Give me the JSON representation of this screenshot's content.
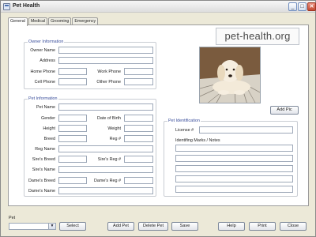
{
  "window": {
    "title": "Pet Health"
  },
  "title_controls": {
    "minimize": "_",
    "maximize": "□",
    "close": "✕"
  },
  "tabs": [
    "General",
    "Medical",
    "Grooming",
    "Emergency"
  ],
  "logo_text": "pet-health.org",
  "owner_info": {
    "title": "Owner Information",
    "labels": {
      "owner_name": "Owner Name",
      "address": "Address",
      "home_phone": "Home Phone",
      "work_phone": "Work Phone",
      "cell_phone": "Cell Phone",
      "other_phone": "Other Phone"
    }
  },
  "pet_info": {
    "title": "Pet Information",
    "labels": {
      "pet_name": "Pet Name",
      "gender": "Gender",
      "date_of_birth": "Date of Birth",
      "height": "Height",
      "weight": "Weight",
      "breed": "Breed",
      "reg_num": "Reg #",
      "reg_name": "Reg Name",
      "sires_breed": "Sire's Breed",
      "sires_reg": "Sire's Reg #",
      "sires_name": "Sire's Name",
      "dames_breed": "Dame's Breed",
      "dames_reg": "Dame's Reg #",
      "dames_name": "Dame's Name"
    }
  },
  "pet_id": {
    "title": "Pet Identification",
    "license_label": "License #",
    "marks_label": "Identifing Marks / Notes"
  },
  "buttons": {
    "add_pic": "Add Pic",
    "select": "Select",
    "add_pet": "Add Pet",
    "delete_pet": "Delete Pet",
    "save": "Save",
    "help": "Help",
    "print": "Print",
    "close": "Close"
  },
  "bottom": {
    "pet_label": "Pet",
    "combo_arrow": "▼"
  },
  "colors": {
    "group_title": "#3a4e9b",
    "window_bg": "#ece9d8"
  }
}
